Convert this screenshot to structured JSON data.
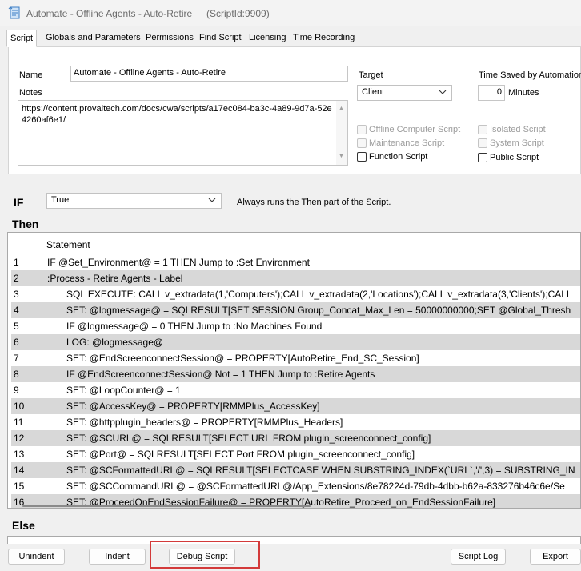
{
  "window": {
    "title": "Automate - Offline Agents - Auto-Retire",
    "script_id": "(ScriptId:9909)"
  },
  "tabs": [
    {
      "label": "Script",
      "active": true
    },
    {
      "label": "Globals and Parameters",
      "active": false
    },
    {
      "label": "Permissions",
      "active": false
    },
    {
      "label": "Find Script",
      "active": false
    },
    {
      "label": "Licensing",
      "active": false
    },
    {
      "label": "Time Recording",
      "active": false
    }
  ],
  "form": {
    "name_label": "Name",
    "name_value": "Automate - Offline Agents - Auto-Retire",
    "notes_label": "Notes",
    "notes_value": "https://content.provaltech.com/docs/cwa/scripts/a17ec084-ba3c-4a89-9d7a-52e4260af6e1/",
    "target_label": "Target",
    "target_value": "Client",
    "time_saved_label": "Time Saved by Automation",
    "time_saved_value": "0",
    "minutes_label": "Minutes",
    "checkboxes": [
      {
        "label": "Offline Computer Script",
        "checked": false,
        "enabled": false
      },
      {
        "label": "Maintenance Script",
        "checked": false,
        "enabled": false
      },
      {
        "label": "Function Script",
        "checked": false,
        "enabled": true
      },
      {
        "label": "Isolated Script",
        "checked": false,
        "enabled": false
      },
      {
        "label": "System Script",
        "checked": false,
        "enabled": false
      },
      {
        "label": "Public Script",
        "checked": false,
        "enabled": true
      }
    ]
  },
  "if_section": {
    "label": "IF",
    "condition": "True",
    "hint": "Always runs the Then part of the Script."
  },
  "then_section": {
    "label": "Then",
    "column_header": "Statement",
    "rows": [
      {
        "num": "1",
        "indent": 0,
        "text": "IF  @Set_Environment@  =  1  THEN  Jump to :Set Environment"
      },
      {
        "num": "2",
        "indent": 0,
        "text": ":Process - Retire Agents - Label"
      },
      {
        "num": "3",
        "indent": 1,
        "text": "SQL EXECUTE: CALL v_extradata(1,'Computers');CALL v_extradata(2,'Locations');CALL v_extradata(3,'Clients');CALL"
      },
      {
        "num": "4",
        "indent": 1,
        "text": "SET:  @logmessage@ = SQLRESULT[SET SESSION Group_Concat_Max_Len = 50000000000;SET @Global_Thresh"
      },
      {
        "num": "5",
        "indent": 1,
        "text": "IF  @logmessage@  =  0  THEN  Jump to :No Machines Found"
      },
      {
        "num": "6",
        "indent": 1,
        "text": "LOG:  @logmessage@"
      },
      {
        "num": "7",
        "indent": 1,
        "text": "SET:  @EndScreenconnectSession@ = PROPERTY[AutoRetire_End_SC_Session]"
      },
      {
        "num": "8",
        "indent": 1,
        "text": "IF  @EndScreenconnectSession@  Not =  1  THEN  Jump to :Retire Agents"
      },
      {
        "num": "9",
        "indent": 1,
        "text": "SET:  @LoopCounter@ = 1"
      },
      {
        "num": "10",
        "indent": 1,
        "text": "SET:  @AccessKey@ = PROPERTY[RMMPlus_AccessKey]"
      },
      {
        "num": "11",
        "indent": 1,
        "text": "SET:  @httpplugin_headers@ = PROPERTY[RMMPlus_Headers]"
      },
      {
        "num": "12",
        "indent": 1,
        "text": "SET:  @SCURL@ = SQLRESULT[SELECT URL FROM plugin_screenconnect_config]"
      },
      {
        "num": "13",
        "indent": 1,
        "text": "SET:  @Port@ = SQLRESULT[SELECT Port FROM plugin_screenconnect_config]"
      },
      {
        "num": "14",
        "indent": 1,
        "text": "SET:  @SCFormattedURL@ = SQLRESULT[SELECTCASE WHEN SUBSTRING_INDEX(`URL`,'/',3) = SUBSTRING_IN"
      },
      {
        "num": "15",
        "indent": 1,
        "text": "SET:  @SCCommandURL@ = @SCFormattedURL@/App_Extensions/8e78224d-79db-4dbb-b62a-833276b46c6e/Se"
      },
      {
        "num": "16",
        "indent": 1,
        "text": "SET:  @ProceedOnEndSessionFailure@ = PROPERTY[AutoRetire_Proceed_on_EndSessionFailure]"
      }
    ]
  },
  "else_section": {
    "label": "Else"
  },
  "buttons": {
    "unindent": "Unindent",
    "indent": "Indent",
    "debug_script": "Debug Script",
    "script_log": "Script Log",
    "export": "Export"
  },
  "colors": {
    "shaded_row": "#d8d8d8",
    "highlight_border": "#d33a3a"
  }
}
